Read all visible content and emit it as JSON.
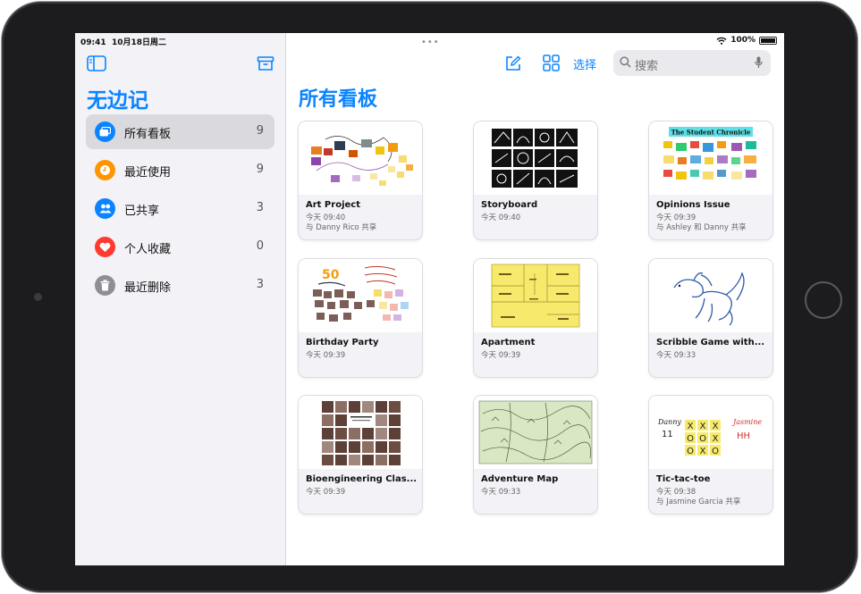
{
  "status": {
    "time": "09:41",
    "date": "10月18日周二",
    "battery": "100%"
  },
  "sidebar": {
    "title": "无边记",
    "items": [
      {
        "label": "所有看板",
        "count": "9",
        "icon": "boards-icon",
        "color": "#0a84ff"
      },
      {
        "label": "最近使用",
        "count": "9",
        "icon": "clock-icon",
        "color": "#ff9500"
      },
      {
        "label": "已共享",
        "count": "3",
        "icon": "people-icon",
        "color": "#0a84ff"
      },
      {
        "label": "个人收藏",
        "count": "0",
        "icon": "heart-icon",
        "color": "#ff3b30"
      },
      {
        "label": "最近删除",
        "count": "3",
        "icon": "trash-icon",
        "color": "#8e8e93"
      }
    ]
  },
  "toolbar": {
    "select_label": "选择",
    "search_placeholder": "搜索"
  },
  "main": {
    "title": "所有看板"
  },
  "boards": [
    {
      "name": "Art Project",
      "time": "今天 09:40",
      "share": "与 Danny Rico 共享"
    },
    {
      "name": "Storyboard",
      "time": "今天 09:40",
      "share": ""
    },
    {
      "name": "Opinions Issue",
      "time": "今天 09:39",
      "share": "与 Ashley 和 Danny 共享",
      "thumb_text": "The Student Chronicle"
    },
    {
      "name": "Birthday Party",
      "time": "今天 09:39",
      "share": "",
      "thumb_text": "50"
    },
    {
      "name": "Apartment",
      "time": "今天 09:39",
      "share": ""
    },
    {
      "name": "Scribble Game with...",
      "time": "今天 09:33",
      "share": ""
    },
    {
      "name": "Bioengineering Clas...",
      "time": "今天 09:39",
      "share": ""
    },
    {
      "name": "Adventure Map",
      "time": "今天 09:33",
      "share": ""
    },
    {
      "name": "Tic-tac-toe",
      "time": "今天 09:38",
      "share": "与 Jasmine Garcia 共享",
      "thumb_labels": [
        "Danny",
        "Jasmine"
      ]
    }
  ]
}
